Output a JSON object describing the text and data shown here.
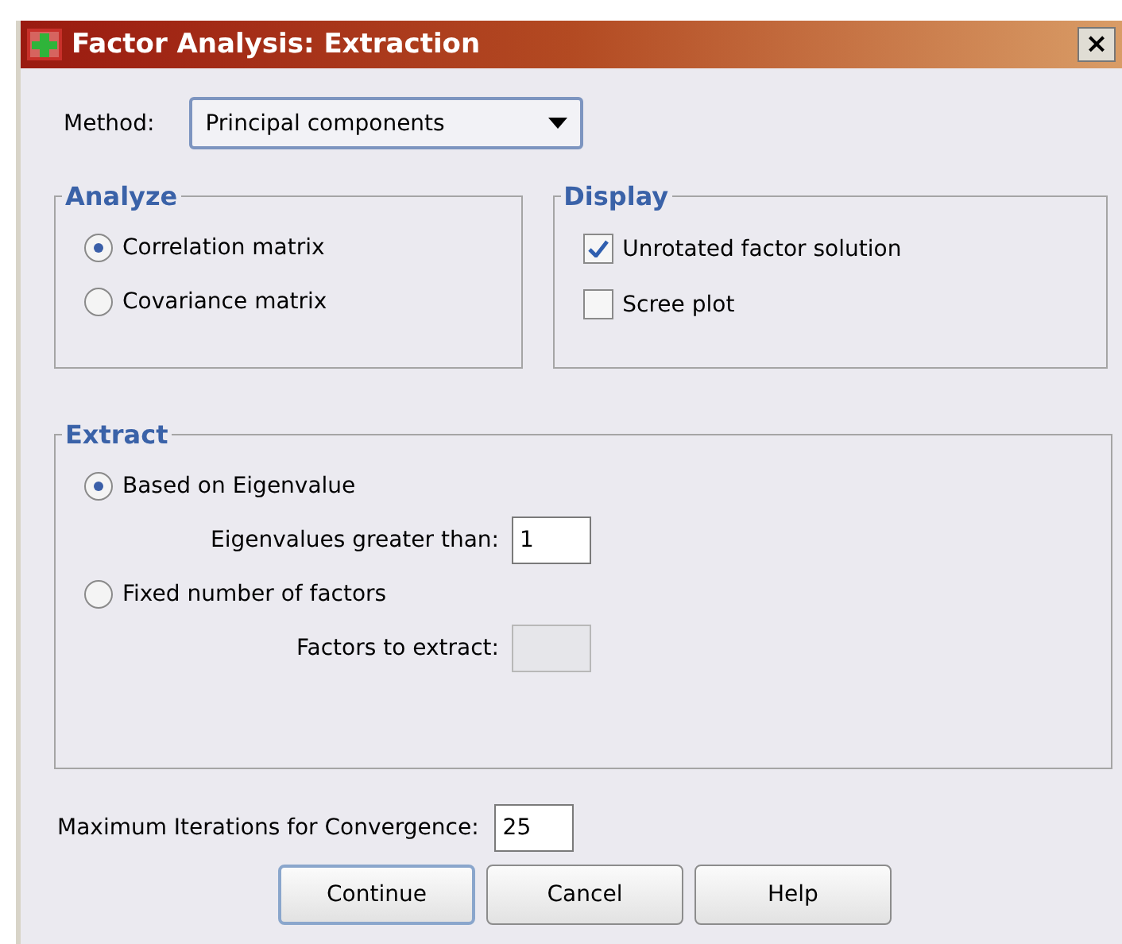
{
  "window": {
    "title": "Factor Analysis: Extraction",
    "close": "×"
  },
  "method": {
    "label": "Method:",
    "value": "Principal components"
  },
  "analyze": {
    "title": "Analyze",
    "options": [
      {
        "label": "Correlation matrix",
        "selected": true
      },
      {
        "label": "Covariance matrix",
        "selected": false
      }
    ]
  },
  "display": {
    "title": "Display",
    "options": [
      {
        "label": "Unrotated factor solution",
        "checked": true
      },
      {
        "label": "Scree plot",
        "checked": false
      }
    ]
  },
  "extract": {
    "title": "Extract",
    "options": [
      {
        "label": "Based on Eigenvalue",
        "selected": true,
        "field": {
          "label": "Eigenvalues greater than:",
          "value": "1",
          "disabled": false
        }
      },
      {
        "label": "Fixed number of factors",
        "selected": false,
        "field": {
          "label": "Factors to extract:",
          "disabled": true
        }
      }
    ]
  },
  "iterations": {
    "label": "Maximum Iterations for Convergence:",
    "value": "25"
  },
  "buttons": [
    {
      "label": "Continue",
      "default": true
    },
    {
      "label": "Cancel",
      "default": false
    },
    {
      "label": "Help",
      "default": false
    }
  ]
}
